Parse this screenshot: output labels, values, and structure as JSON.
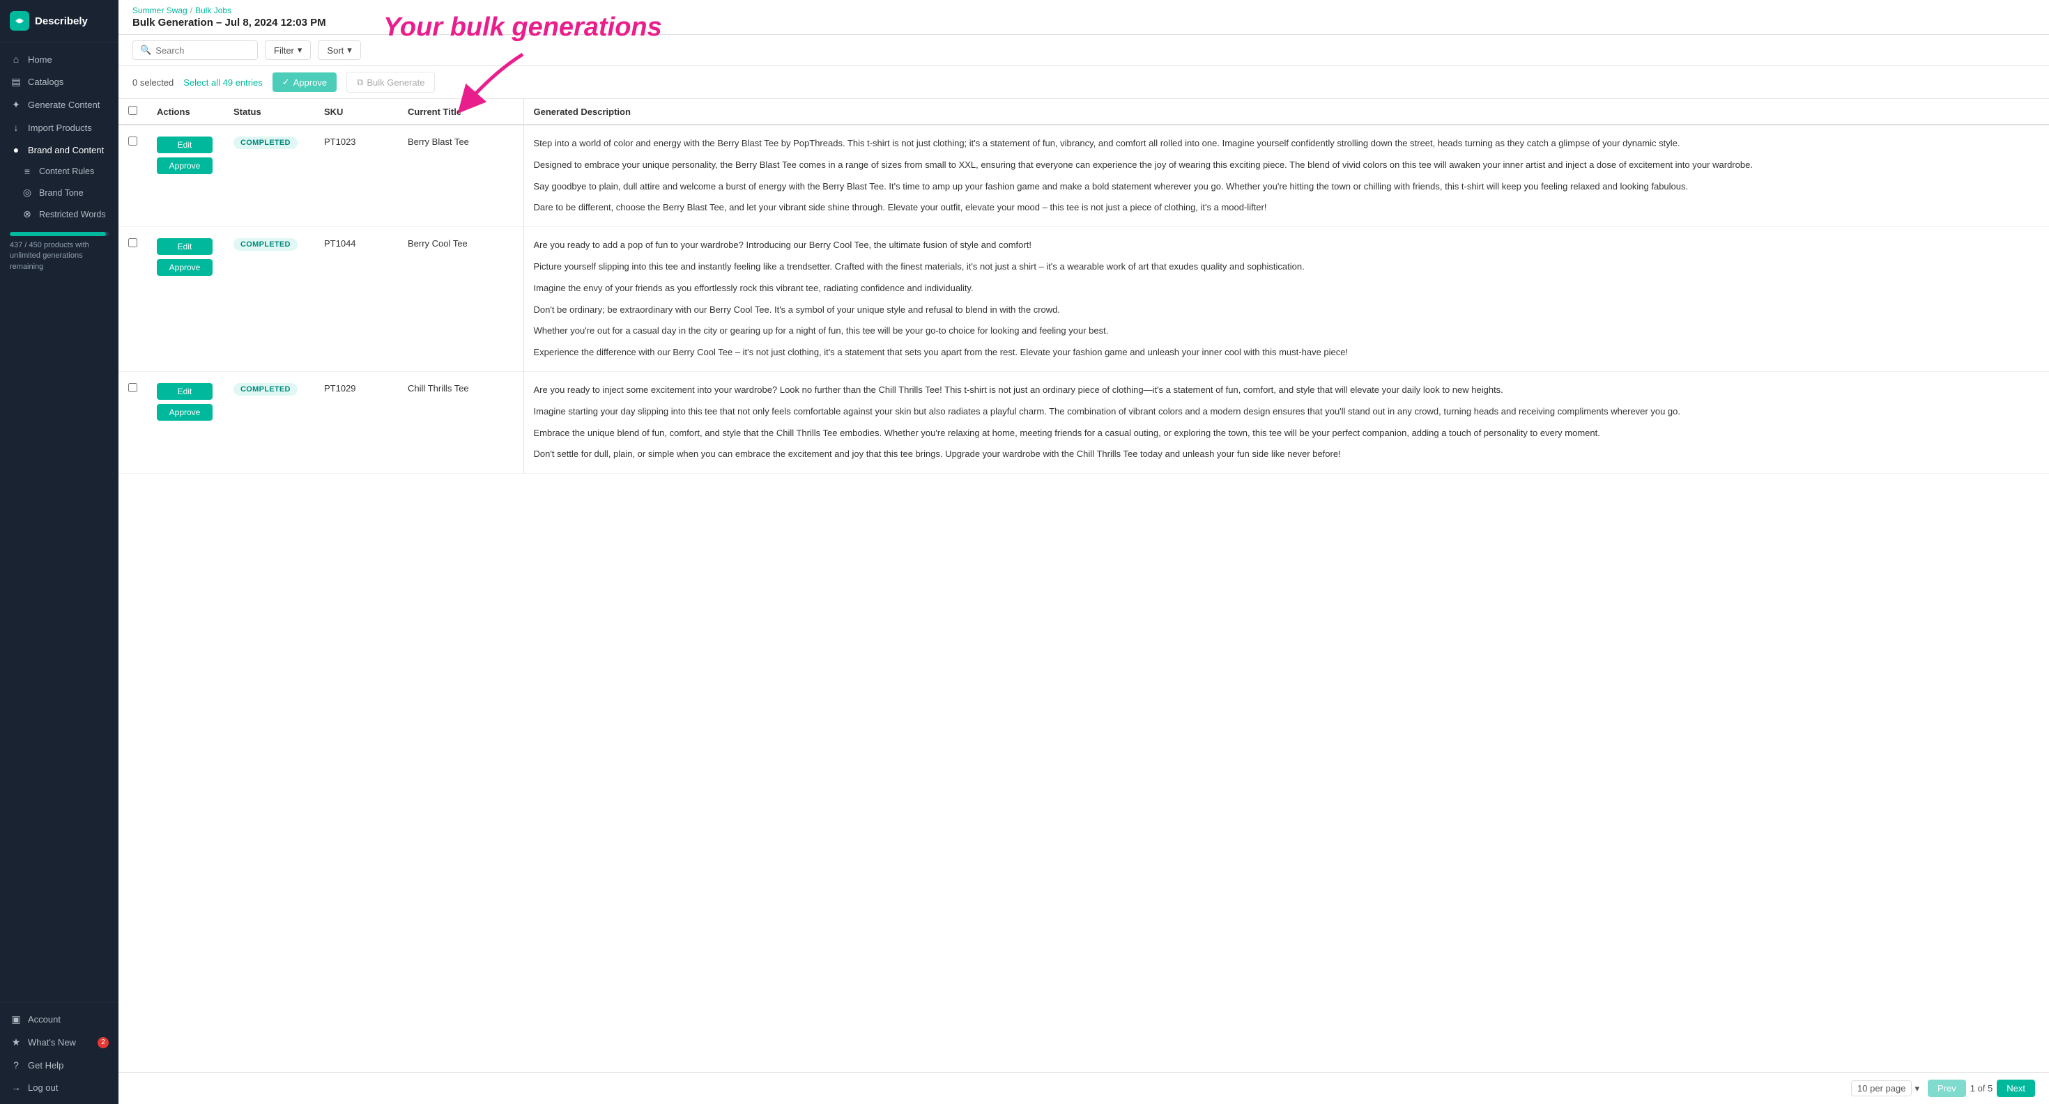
{
  "sidebar": {
    "logo_text": "Describely",
    "logo_icon": "D",
    "nav_items": [
      {
        "label": "Home",
        "icon": "⌂",
        "id": "home"
      },
      {
        "label": "Catalogs",
        "icon": "▤",
        "id": "catalogs"
      }
    ],
    "brand_section": {
      "label": "Brand and Content",
      "items": [
        {
          "label": "Generate Content",
          "icon": "✦",
          "id": "generate-content"
        },
        {
          "label": "Import Products",
          "icon": "↓",
          "id": "import-products"
        },
        {
          "label": "Brand and Content",
          "icon": "●",
          "id": "brand-and-content"
        }
      ],
      "sub_items": [
        {
          "label": "Content Rules",
          "icon": "≡",
          "id": "content-rules"
        },
        {
          "label": "Brand Tone",
          "icon": "◎",
          "id": "brand-tone"
        },
        {
          "label": "Restricted Words",
          "icon": "⊗",
          "id": "restricted-words"
        }
      ]
    },
    "progress": {
      "text": "437 / 450 products with unlimited generations remaining",
      "value": 97
    },
    "bottom_items": [
      {
        "label": "Account",
        "icon": "▣",
        "id": "account",
        "badge": null
      },
      {
        "label": "What's New",
        "icon": "★",
        "id": "whats-new",
        "badge": "2"
      },
      {
        "label": "Get Help",
        "icon": "?",
        "id": "get-help",
        "badge": null
      },
      {
        "label": "Log out",
        "icon": "→",
        "id": "log-out",
        "badge": null
      }
    ]
  },
  "breadcrumb": {
    "parent": "Summer Swag",
    "current": "Bulk Jobs",
    "separator": "/"
  },
  "page_title": "Bulk Generation – Jul 8, 2024 12:03 PM",
  "toolbar": {
    "search_placeholder": "Search",
    "filter_label": "Filter",
    "sort_label": "Sort"
  },
  "selection_bar": {
    "selected_count": "0 selected",
    "select_all_label": "Select all 49 entries",
    "approve_label": "Approve",
    "bulk_generate_label": "Bulk Generate"
  },
  "table": {
    "columns": [
      {
        "label": "",
        "id": "checkbox"
      },
      {
        "label": "Actions",
        "id": "actions"
      },
      {
        "label": "Status",
        "id": "status"
      },
      {
        "label": "SKU",
        "id": "sku"
      },
      {
        "label": "Current Title",
        "id": "title"
      },
      {
        "label": "Generated Description",
        "id": "description"
      }
    ],
    "rows": [
      {
        "id": "row1",
        "status": "COMPLETED",
        "sku": "PT1023",
        "title": "Berry Blast Tee",
        "edit_label": "Edit",
        "approve_label": "Approve",
        "description_paragraphs": [
          "Step into a world of color and energy with the Berry Blast Tee by PopThreads. This t-shirt is not just clothing; it's a statement of fun, vibrancy, and comfort all rolled into one. Imagine yourself confidently strolling down the street, heads turning as they catch a glimpse of your dynamic style.",
          "Designed to embrace your unique personality, the Berry Blast Tee comes in a range of sizes from small to XXL, ensuring that everyone can experience the joy of wearing this exciting piece. The blend of vivid colors on this tee will awaken your inner artist and inject a dose of excitement into your wardrobe.",
          "Say goodbye to plain, dull attire and welcome a burst of energy with the Berry Blast Tee. It's time to amp up your fashion game and make a bold statement wherever you go. Whether you're hitting the town or chilling with friends, this t-shirt will keep you feeling relaxed and looking fabulous.",
          "Dare to be different, choose the Berry Blast Tee, and let your vibrant side shine through. Elevate your outfit, elevate your mood – this tee is not just a piece of clothing, it's a mood-lifter!"
        ]
      },
      {
        "id": "row2",
        "status": "COMPLETED",
        "sku": "PT1044",
        "title": "Berry Cool Tee",
        "edit_label": "Edit",
        "approve_label": "Approve",
        "description_paragraphs": [
          "Are you ready to add a pop of fun to your wardrobe? Introducing our Berry Cool Tee, the ultimate fusion of style and comfort!",
          "Picture yourself slipping into this tee and instantly feeling like a trendsetter. Crafted with the finest materials, it's not just a shirt – it's a wearable work of art that exudes quality and sophistication.",
          "Imagine the envy of your friends as you effortlessly rock this vibrant tee, radiating confidence and individuality.",
          "Don't be ordinary; be extraordinary with our Berry Cool Tee. It's a symbol of your unique style and refusal to blend in with the crowd.",
          "Whether you're out for a casual day in the city or gearing up for a night of fun, this tee will be your go-to choice for looking and feeling your best.",
          "Experience the difference with our Berry Cool Tee – it's not just clothing, it's a statement that sets you apart from the rest. Elevate your fashion game and unleash your inner cool with this must-have piece!"
        ]
      },
      {
        "id": "row3",
        "status": "COMPLETED",
        "sku": "PT1029",
        "title": "Chill Thrills Tee",
        "edit_label": "Edit",
        "approve_label": "Approve",
        "description_paragraphs": [
          "Are you ready to inject some excitement into your wardrobe? Look no further than the Chill Thrills Tee! This t-shirt is not just an ordinary piece of clothing—it's a statement of fun, comfort, and style that will elevate your daily look to new heights.",
          "Imagine starting your day slipping into this tee that not only feels comfortable against your skin but also radiates a playful charm. The combination of vibrant colors and a modern design ensures that you'll stand out in any crowd, turning heads and receiving compliments wherever you go.",
          "Embrace the unique blend of fun, comfort, and style that the Chill Thrills Tee embodies. Whether you're relaxing at home, meeting friends for a casual outing, or exploring the town, this tee will be your perfect companion, adding a touch of personality to every moment.",
          "Don't settle for dull, plain, or simple when you can embrace the excitement and joy that this tee brings. Upgrade your wardrobe with the Chill Thrills Tee today and unleash your fun side like never before!"
        ]
      }
    ]
  },
  "footer": {
    "per_page_label": "10 per page",
    "page_current": "1",
    "page_total": "5",
    "page_of": "of",
    "prev_label": "Prev",
    "next_label": "Next"
  },
  "annotation": {
    "title": "Your bulk generations"
  }
}
